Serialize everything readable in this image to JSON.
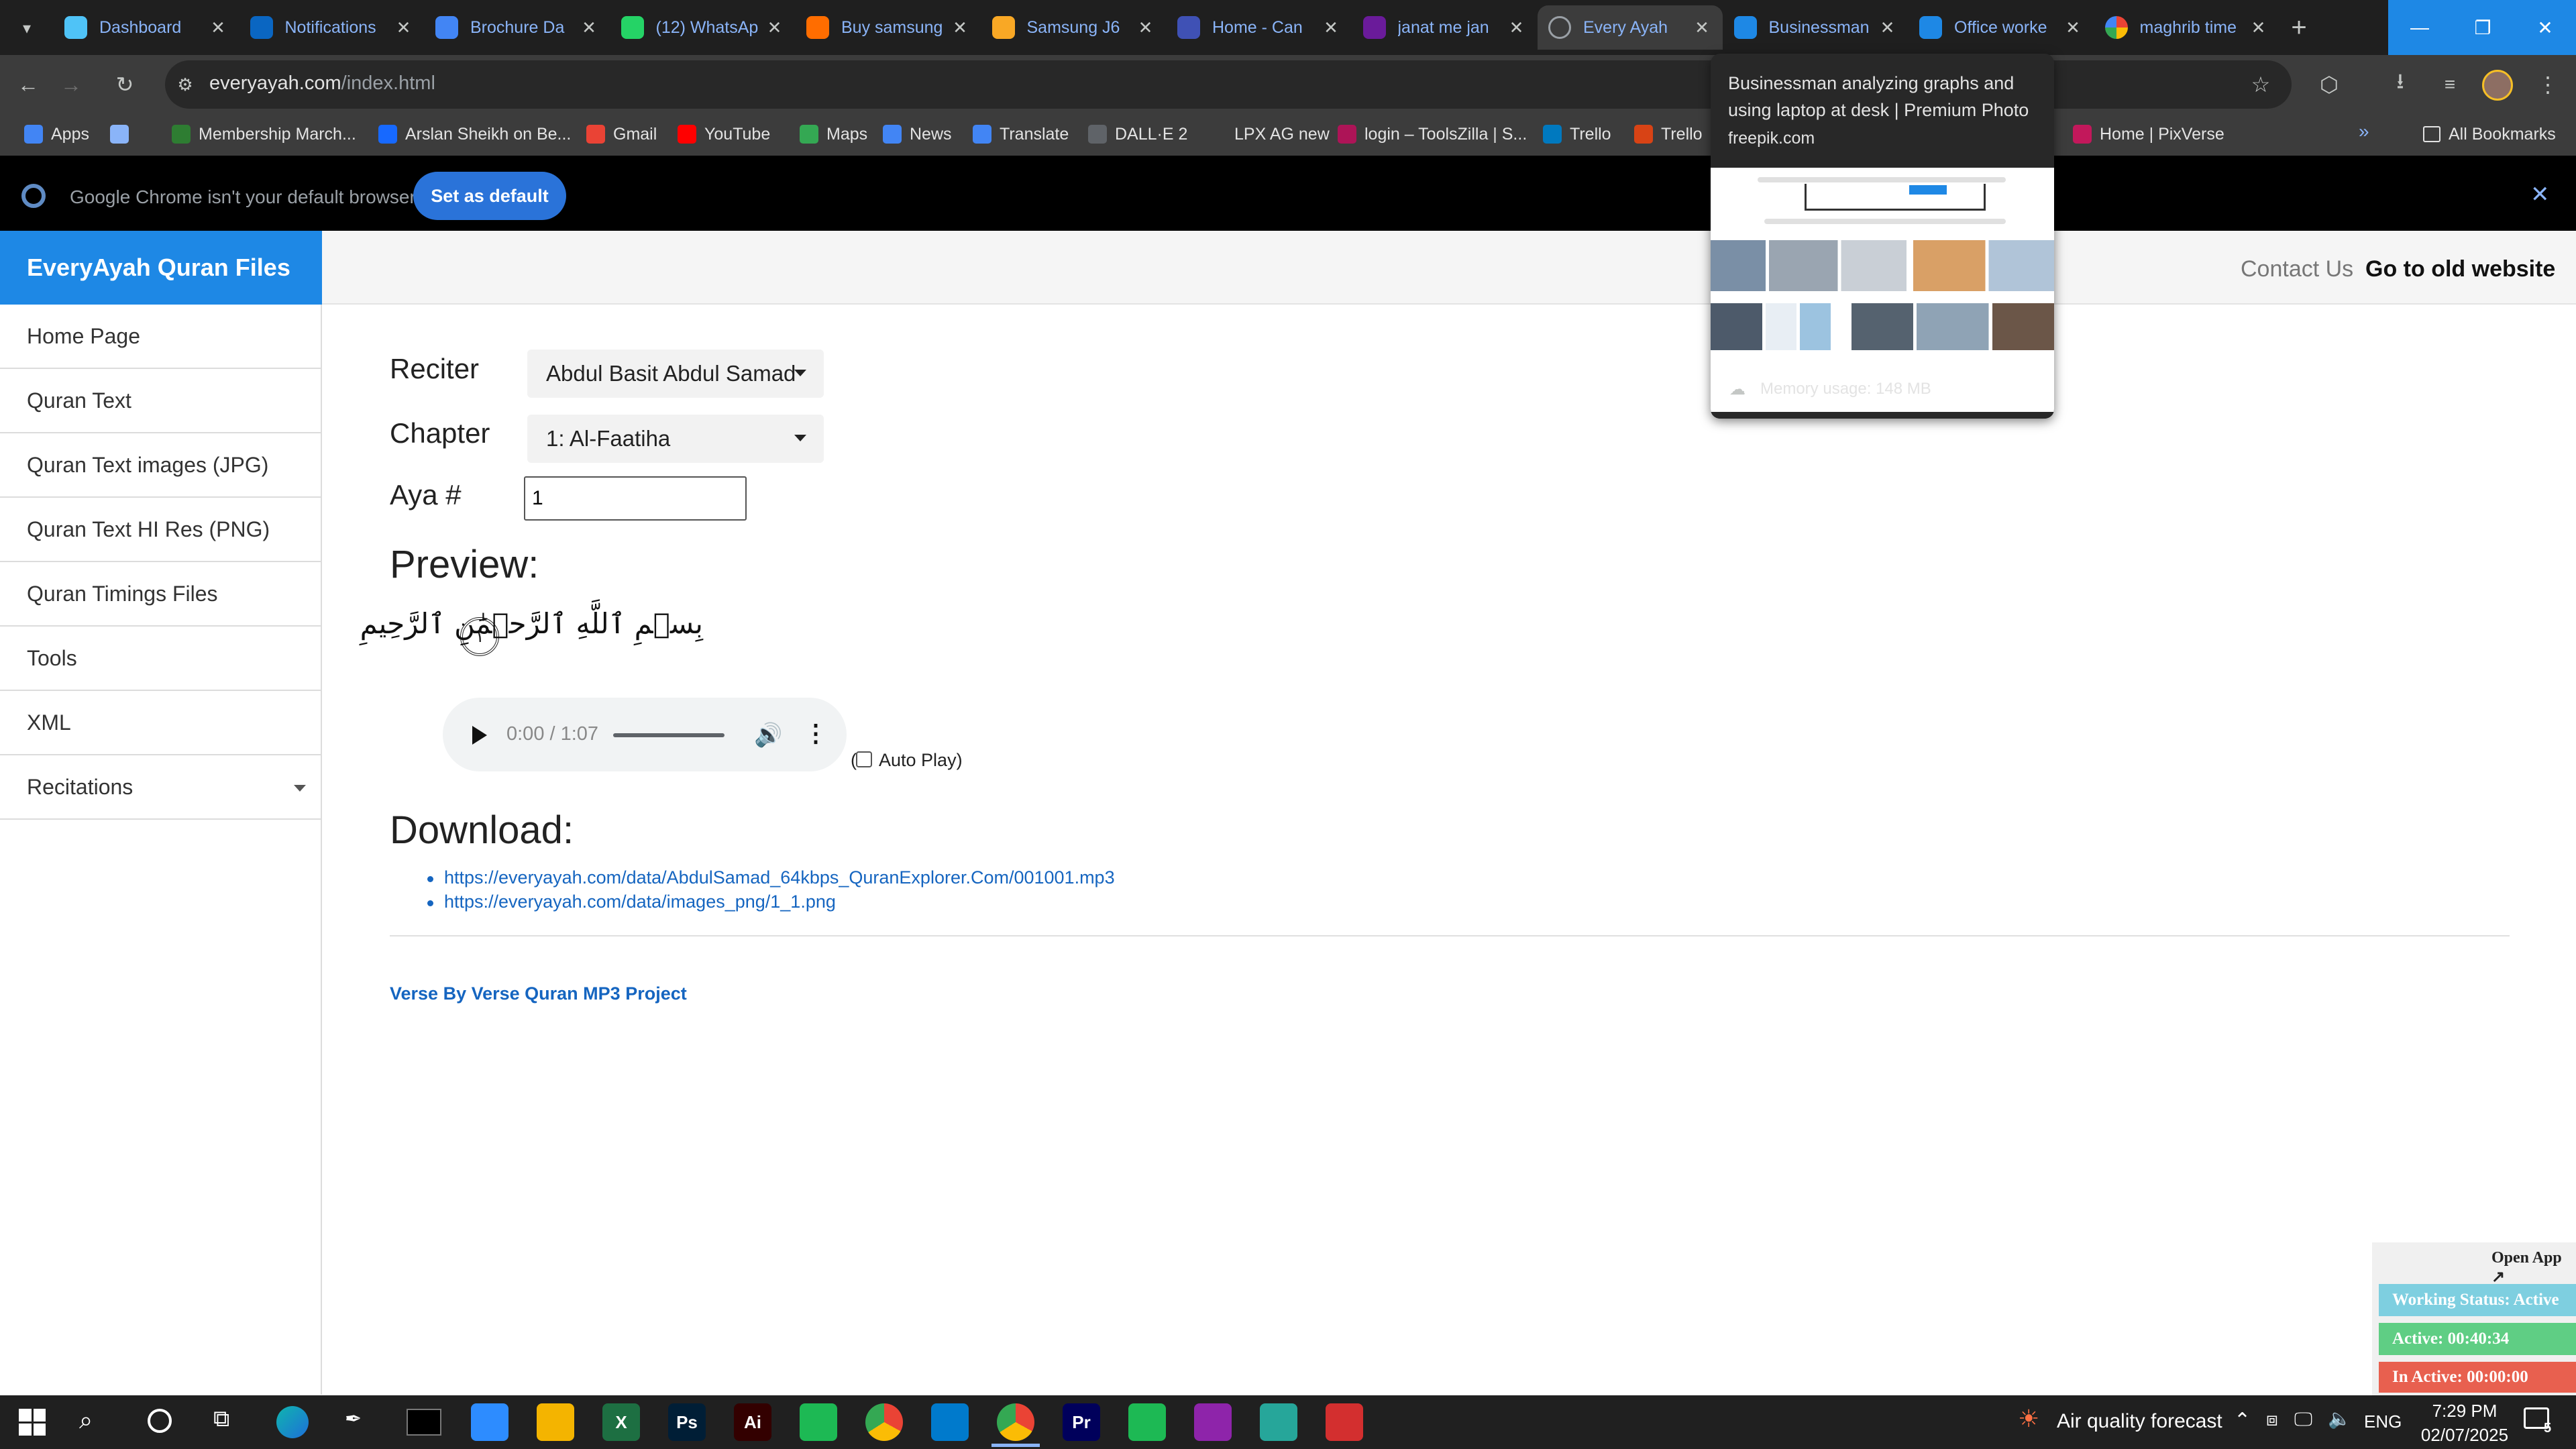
{
  "browser": {
    "tabs": [
      {
        "title": "Dashboard",
        "icon": "dashboard-favicon",
        "color": "#4fc3f7"
      },
      {
        "title": "Notifications",
        "icon": "linkedin-favicon",
        "color": "#0a66c2"
      },
      {
        "title": "Brochure Da",
        "icon": "docs-favicon",
        "color": "#4285f4"
      },
      {
        "title": "(12) WhatsAp",
        "icon": "whatsapp-favicon",
        "color": "#25d366"
      },
      {
        "title": "Buy samsung",
        "icon": "flame-favicon",
        "color": "#ff6d00"
      },
      {
        "title": "Samsung J6",
        "icon": "samsung-favicon",
        "color": "#f9a825"
      },
      {
        "title": "Home - Can",
        "icon": "canva-favicon",
        "color": "#3f51b5"
      },
      {
        "title": "janat me jan",
        "icon": "video-favicon",
        "color": "#6a1b9a"
      },
      {
        "title": "Every Ayah",
        "icon": "globe-favicon",
        "color": "#5f6368"
      },
      {
        "title": "Businessman",
        "icon": "freepik-favicon",
        "color": "#1e88e5"
      },
      {
        "title": "Office worke",
        "icon": "freepik-favicon",
        "color": "#1e88e5"
      },
      {
        "title": "maghrib time",
        "icon": "google-favicon",
        "color": "#ffffff"
      }
    ],
    "url_host": "everyayah.com",
    "url_path": "/index.html",
    "bookmarks": [
      {
        "label": "Apps",
        "icon": "apps-grid-icon",
        "color": "#4285f4"
      },
      {
        "label": "",
        "icon": "tab-groups-icon",
        "color": "#8ab4f8"
      },
      {
        "label": "Membership March...",
        "icon": "plus-green-favicon",
        "color": "#2e7d32"
      },
      {
        "label": "Arslan Sheikh on Be...",
        "icon": "behance-favicon",
        "color": "#1769ff"
      },
      {
        "label": "Gmail",
        "icon": "gmail-favicon",
        "color": "#ea4335"
      },
      {
        "label": "YouTube",
        "icon": "youtube-favicon",
        "color": "#ff0000"
      },
      {
        "label": "Maps",
        "icon": "maps-favicon",
        "color": "#34a853"
      },
      {
        "label": "News",
        "icon": "news-favicon",
        "color": "#4285f4"
      },
      {
        "label": "Translate",
        "icon": "translate-favicon",
        "color": "#4285f4"
      },
      {
        "label": "DALL·E 2",
        "icon": "openai-favicon",
        "color": "#5f6368"
      },
      {
        "label": "LPX AG new",
        "icon": "blank-favicon",
        "color": "#3c3c3c"
      },
      {
        "label": "login – ToolsZilla | S...",
        "icon": "toolszilla-favicon",
        "color": "#ad1457"
      },
      {
        "label": "Trello",
        "icon": "trello-favicon",
        "color": "#0079bf"
      },
      {
        "label": "Trello",
        "icon": "trello-favicon",
        "color": "#d84315"
      },
      {
        "label": "Home | PixVerse",
        "icon": "pixverse-favicon",
        "color": "#c2185b"
      }
    ],
    "all_bookmarks": "All Bookmarks",
    "infobar_text": "Google Chrome isn't your default browser",
    "set_default_label": "Set as default"
  },
  "tab_hover_card": {
    "title": "Businessman analyzing graphs and using laptop at desk | Premium Photo",
    "domain": "freepik.com",
    "memory": "Memory usage: 148 MB"
  },
  "site": {
    "brand": "EveryAyah Quran Files",
    "contact_us": "Contact Us",
    "old_website": "Go to old website",
    "sidebar": [
      {
        "label": "Home Page"
      },
      {
        "label": "Quran Text"
      },
      {
        "label": "Quran Text images (JPG)"
      },
      {
        "label": "Quran Text HI Res (PNG)"
      },
      {
        "label": "Quran Timings Files"
      },
      {
        "label": "Tools"
      },
      {
        "label": "XML"
      },
      {
        "label": "Recitations"
      }
    ],
    "form": {
      "reciter_label": "Reciter",
      "reciter_value": "Abdul Basit Abdul Samad",
      "chapter_label": "Chapter",
      "chapter_value": "1: Al-Faatiha",
      "aya_label": "Aya #",
      "aya_value": "1"
    },
    "preview_heading": "Preview:",
    "verse_text": "بِسۡمِ ٱللَّهِ ٱلرَّحۡمَٰنِ ٱلرَّحِيمِ",
    "verse_number": "١",
    "audio": {
      "time": "0:00 / 1:07"
    },
    "auto_play_open": "(",
    "auto_play_label": "Auto Play)",
    "download_heading": "Download:",
    "download_links": [
      "https://everyayah.com/data/AbdulSamad_64kbps_QuranExplorer.Com/001001.mp3",
      "https://everyayah.com/data/images_png/1_1.png"
    ],
    "footer_link": "Verse By Verse Quran MP3 Project"
  },
  "tracker": {
    "open_app": "Open App ↗",
    "working_status": "Working Status: Active",
    "active": "Active: 00:40:34",
    "inactive": "In Active: 00:00:00",
    "colors": {
      "status": "#7ecfe0",
      "active": "#5fce84",
      "inactive": "#e8604f"
    }
  },
  "taskbar": {
    "weather": "Air quality forecast",
    "language": "ENG",
    "time": "7:29 PM",
    "date": "02/07/2025",
    "notifications": "5",
    "apps": [
      {
        "label": "",
        "icon": "zoom-app-icon",
        "color": "#2d8cff"
      },
      {
        "label": "",
        "icon": "file-explorer-icon",
        "color": "#f4b400"
      },
      {
        "label": "X",
        "icon": "excel-icon",
        "color": "#1d6f42"
      },
      {
        "label": "Ps",
        "icon": "photoshop-icon",
        "color": "#001e36"
      },
      {
        "label": "Ai",
        "icon": "illustrator-icon",
        "color": "#330000"
      },
      {
        "label": "",
        "icon": "green-app-icon",
        "color": "#1db954"
      },
      {
        "label": "",
        "icon": "chrome-icon",
        "color": "#4285f4"
      },
      {
        "label": "",
        "icon": "vscode-icon",
        "color": "#007acc"
      },
      {
        "label": "",
        "icon": "chrome-icon",
        "color": "#4285f4"
      },
      {
        "label": "Pr",
        "icon": "premiere-icon",
        "color": "#00005b"
      },
      {
        "label": "",
        "icon": "green-app-icon",
        "color": "#1db954"
      },
      {
        "label": "",
        "icon": "winrar-icon",
        "color": "#8e24aa"
      },
      {
        "label": "",
        "icon": "diamond-app-icon",
        "color": "#26a69a"
      },
      {
        "label": "",
        "icon": "acrobat-icon",
        "color": "#d32f2f"
      }
    ]
  }
}
